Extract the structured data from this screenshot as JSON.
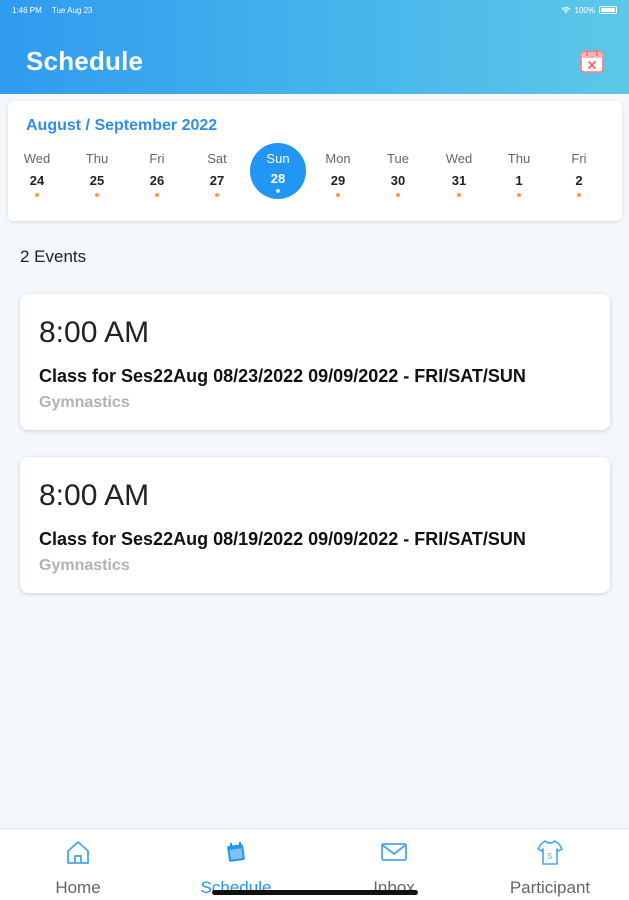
{
  "status": {
    "time": "1:46 PM",
    "date": "Tue Aug 23",
    "battery": "100%"
  },
  "header": {
    "title": "Schedule",
    "calendar_icon": "calendar-x-icon"
  },
  "calendar": {
    "month_label": "August / September 2022",
    "days": [
      {
        "name": "Wed",
        "num": "24",
        "has_event": true
      },
      {
        "name": "Thu",
        "num": "25",
        "has_event": true
      },
      {
        "name": "Fri",
        "num": "26",
        "has_event": true
      },
      {
        "name": "Sat",
        "num": "27",
        "has_event": true
      },
      {
        "name": "Sun",
        "num": "28",
        "has_event": true,
        "selected": true
      },
      {
        "name": "Mon",
        "num": "29",
        "has_event": true
      },
      {
        "name": "Tue",
        "num": "30",
        "has_event": true
      },
      {
        "name": "Wed",
        "num": "31",
        "has_event": true
      },
      {
        "name": "Thu",
        "num": "1",
        "has_event": true
      },
      {
        "name": "Fri",
        "num": "2",
        "has_event": true
      }
    ]
  },
  "events_count": "2 Events",
  "events": [
    {
      "time": "8:00 AM",
      "title": "Class for Ses22Aug 08/23/2022 09/09/2022 - FRI/SAT/SUN",
      "category": "Gymnastics"
    },
    {
      "time": "8:00 AM",
      "title": "Class for Ses22Aug 08/19/2022 09/09/2022 - FRI/SAT/SUN",
      "category": "Gymnastics"
    }
  ],
  "tabs": [
    {
      "label": "Home",
      "icon": "home-icon"
    },
    {
      "label": "Schedule",
      "icon": "calendar-icon",
      "active": true
    },
    {
      "label": "Inbox",
      "icon": "mail-icon"
    },
    {
      "label": "Participant",
      "icon": "jersey-icon"
    }
  ],
  "colors": {
    "accent": "#2196f3",
    "header_start": "#2f9bf0",
    "header_end": "#5cc8e8",
    "event_dot": "#f5a03a"
  }
}
